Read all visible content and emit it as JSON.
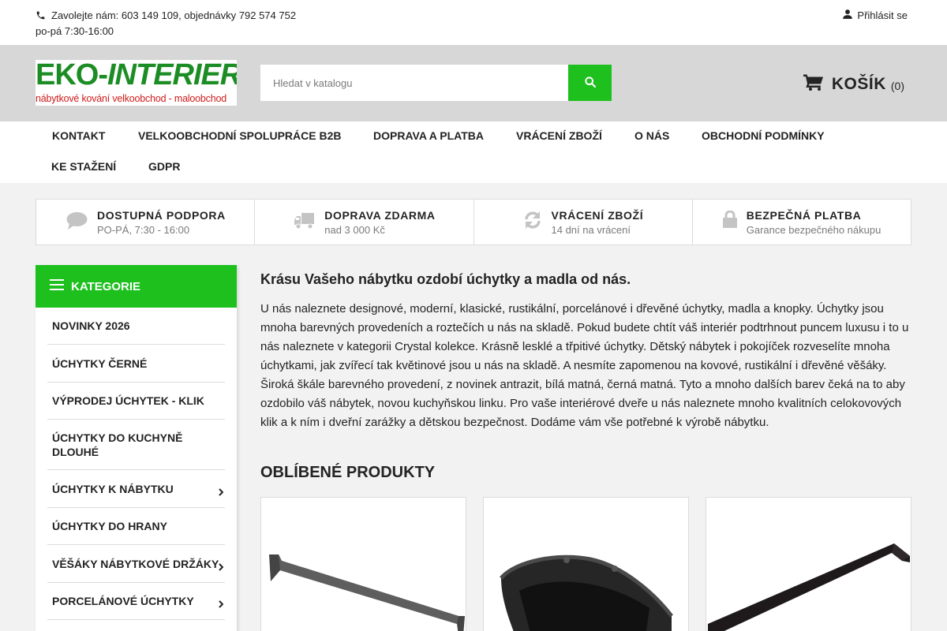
{
  "contact": {
    "line1": "Zavolejte nám: 603 149 109, objednávky 792 574 752",
    "line2": "po-pá 7:30-16:00"
  },
  "login": {
    "label": "Přihlásit se"
  },
  "logo": {
    "main_left": "EKO-",
    "main_right": "INTERIER",
    "sub": "nábytkové kování velkoobchod - maloobchod"
  },
  "search": {
    "placeholder": "Hledat v katalogu"
  },
  "cart": {
    "label": "KOŠÍK",
    "count": "(0)"
  },
  "nav": {
    "items": [
      "KONTAKT",
      "VELKOOBCHODNÍ SPOLUPRÁCE B2B",
      "DOPRAVA A PLATBA",
      "VRÁCENÍ ZBOŽÍ",
      "O NÁS",
      "OBCHODNÍ PODMÍNKY",
      "KE STAŽENÍ",
      "GDPR"
    ]
  },
  "features": [
    {
      "icon": "chat-bubble-icon",
      "title": "DOSTUPNÁ PODPORA",
      "sub": "PO-PÁ, 7:30 - 16:00"
    },
    {
      "icon": "truck-icon",
      "title": "DOPRAVA ZDARMA",
      "sub": "nad 3 000 Kč"
    },
    {
      "icon": "refresh-icon",
      "title": "VRÁCENÍ ZBOŽÍ",
      "sub": "14 dní na vrácení"
    },
    {
      "icon": "lock-icon",
      "title": "BEZPEČNÁ PLATBA",
      "sub": "Garance bezpečného nákupu"
    }
  ],
  "categories": {
    "title": "KATEGORIE",
    "items": [
      "NOVINKY 2026",
      "ÚCHYTKY ČERNÉ",
      "VÝPRODEJ ÚCHYTEK - KLIK",
      "ÚCHYTKY DO KUCHYNĚ DLOUHÉ",
      "ÚCHYTKY K NÁBYTKU",
      "ÚCHYTKY DO HRANY",
      "VĚŠÁKY NÁBYTKOVÉ DRŽÁKY",
      "PORCELÁNOVÉ ÚCHYTKY"
    ]
  },
  "main": {
    "heading": "Krásu Vašeho nábytku ozdobí úchytky a madla od nás.",
    "body": "U nás naleznete designové, moderní, klasické, rustikální, porcelánové i dřevěné úchytky, madla a knopky. Úchytky jsou mnoha barevných provedeních a roztečích u nás na skladě. Pokud budete chtít váš interiér podtrhnout puncem luxusu i to u nás naleznete v kategorii Crystal kolekce. Krásně lesklé a třpitivé úchytky. Dětský nábytek i pokojíček rozveselíte mnoha úchytkami, jak zvířecí tak květinové jsou u nás na skladě. A nesmíte zapomenou na kovové, rustikální i dřevěné věšáky. Široká škále barevného provedení, z novinek antrazit, bílá matná, černá matná. Tyto a mnoho dalších barev čeká na to aby ozdobilo váš nábytek, novou kuchyňskou linku. Pro vaše interiérové dveře u nás naleznete mnoho kvalitních celokovových klik a k ním i dveřní zarážky a dětskou bezpečnost. Dodáme vám vše potřebné k výrobě nábytku.",
    "section_title": "OBLÍBENÉ PRODUKTY"
  },
  "colors": {
    "accent": "#1ec01e",
    "header_bg": "#d7d7d7",
    "logo_green": "#1c8d24",
    "logo_red": "#d01b1b"
  }
}
